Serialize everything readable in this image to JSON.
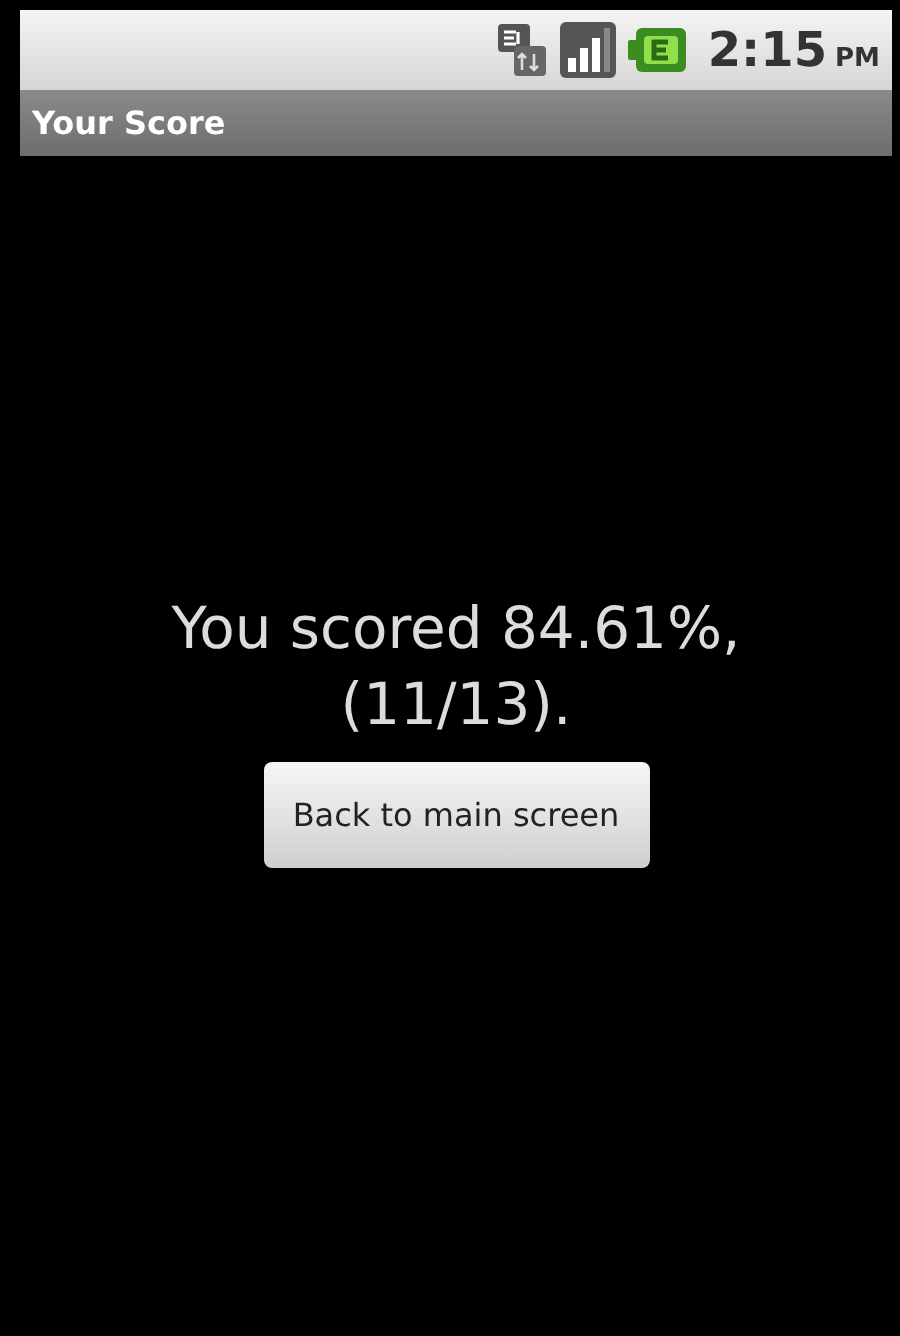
{
  "status_bar": {
    "time": "2:15",
    "meridiem": "PM"
  },
  "title_bar": {
    "title": "Your Score"
  },
  "score": {
    "message": "You scored 84.61%, (11/13).",
    "button": "Back to main screen"
  }
}
